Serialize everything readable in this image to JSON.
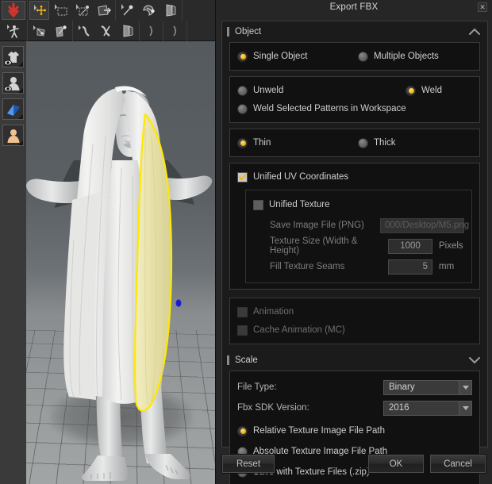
{
  "window": {
    "title": "Export FBX",
    "close_label": "✕"
  },
  "toolbar": {
    "row1": [
      {
        "name": "export-arrow-icon",
        "label": "Export"
      },
      {
        "name": "transform-move-icon",
        "label": "Transform Move"
      },
      {
        "name": "rectangle-select-icon",
        "label": "Rectangle Select"
      },
      {
        "name": "free-select-icon",
        "label": "Free Select"
      },
      {
        "name": "pattern-flip-icon",
        "label": "Flip Pattern"
      },
      {
        "name": "pin-icon",
        "label": "Pin"
      },
      {
        "name": "tack-icon",
        "label": "Tack"
      },
      {
        "name": "fold-arrange-icon",
        "label": "Fold Arrangement"
      }
    ],
    "row2": [
      {
        "name": "avatar-pose-icon",
        "label": "Avatar Pose"
      },
      {
        "name": "segment-sewing-icon",
        "label": "Segment Sewing"
      },
      {
        "name": "free-sewing-icon",
        "label": "Free Sewing"
      },
      {
        "name": "edit-curve-icon",
        "label": "Edit Curve"
      },
      {
        "name": "edit-pattern-icon",
        "label": "Edit Pattern"
      },
      {
        "name": "fold-icon",
        "label": "Fold"
      },
      {
        "name": "zipper-left-icon",
        "label": "Zipper Left"
      },
      {
        "name": "zipper-right-icon",
        "label": "Zipper Right"
      }
    ]
  },
  "rail": {
    "items": [
      {
        "name": "garment-visibility-icon",
        "label": "Show Garment"
      },
      {
        "name": "avatar-visibility-icon",
        "label": "Show Avatar"
      },
      {
        "name": "fabric-thickness-icon",
        "label": "Show Thickness"
      },
      {
        "name": "skin-visibility-icon",
        "label": "Show Skin"
      }
    ]
  },
  "dialog": {
    "sections": {
      "object": {
        "title": "Object",
        "collapse_state": "expanded",
        "object_mode": {
          "options": [
            {
              "label": "Single Object",
              "selected": true
            },
            {
              "label": "Multiple Objects",
              "selected": false
            }
          ]
        },
        "weld_mode": {
          "options": [
            {
              "label": "Unweld",
              "selected": false
            },
            {
              "label": "Weld",
              "selected": true
            },
            {
              "label": "Weld Selected Patterns in Workspace",
              "selected": false
            }
          ]
        },
        "thickness_mode": {
          "options": [
            {
              "label": "Thin",
              "selected": true
            },
            {
              "label": "Thick",
              "selected": false
            }
          ]
        },
        "unified_uv": {
          "label": "Unified UV Coordinates",
          "checked": true
        },
        "unified_texture": {
          "label": "Unified Texture",
          "checked": false,
          "save_image_label": "Save Image File (PNG)",
          "save_image_value": "000/Desktop/M5.png",
          "texture_size_label": "Texture Size (Width & Height)",
          "texture_size_value": "1000",
          "texture_size_unit": "Pixels",
          "fill_seams_label": "Fill Texture Seams",
          "fill_seams_value": "5",
          "fill_seams_unit": "mm"
        },
        "animation": {
          "label": "Animation",
          "checked": false,
          "disabled": true
        },
        "cache_animation": {
          "label": "Cache Animation (MC)",
          "checked": false,
          "disabled": true
        }
      },
      "scale": {
        "title": "Scale",
        "collapse_state": "collapsed",
        "file_type": {
          "label": "File Type:",
          "value": "Binary"
        },
        "fbx_sdk_version": {
          "label": "Fbx SDK Version:",
          "value": "2016"
        },
        "texture_path": {
          "options": [
            {
              "label": "Relative Texture Image File Path",
              "selected": true
            },
            {
              "label": "Absolute Texture Image File Path",
              "selected": false
            },
            {
              "label": "Save with Texture Files (.zip)",
              "selected": false
            }
          ]
        }
      }
    },
    "buttons": {
      "reset": "Reset",
      "ok": "OK",
      "cancel": "Cancel"
    }
  },
  "colors": {
    "accent_orange": "#f5b713",
    "accent_red": "#d8342a",
    "selection_yellow": "#ffe800",
    "garment_yellow": "#e8e3ad",
    "dialog_bg": "#262626",
    "panel_bg": "#111111",
    "marker_blue": "#1a1ad0"
  }
}
